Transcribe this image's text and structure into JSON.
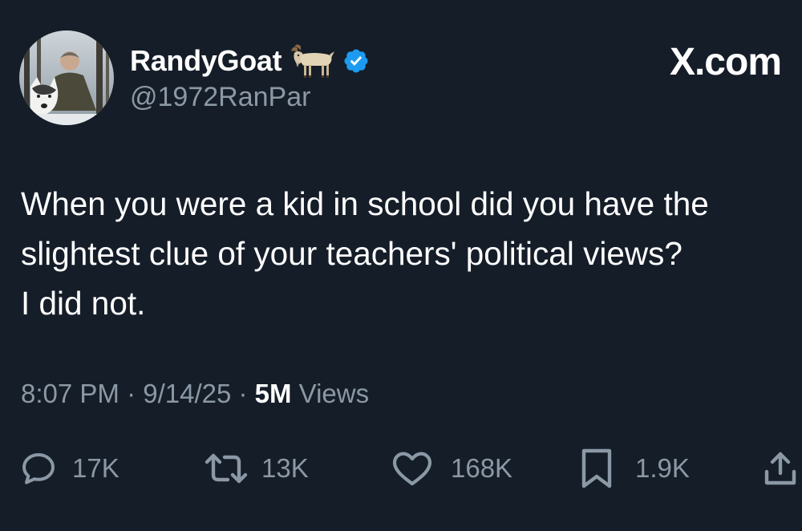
{
  "header": {
    "display_name": "RandyGoat",
    "handle": "@1972RanPar",
    "brand": "X.com",
    "icons": {
      "avatar": "profile-photo-man-with-husky",
      "badge_emoji": "goat-emoji",
      "verified": "verified-badge-icon"
    },
    "colors": {
      "background": "#151d28",
      "verified_blue": "#1d9bf0",
      "secondary_text": "#8b98a5"
    }
  },
  "tweet": {
    "text": "When you were a kid in school did you have the\nslightest clue of your teachers' political views?\nI did not."
  },
  "meta": {
    "time": "8:07 PM",
    "sep1": " · ",
    "date": "9/14/25",
    "sep2": " · ",
    "views_count": "5M",
    "views_label": " Views"
  },
  "actions": {
    "reply": {
      "icon": "reply-icon",
      "count": "17K"
    },
    "repost": {
      "icon": "repost-icon",
      "count": "13K"
    },
    "like": {
      "icon": "heart-icon",
      "count": "168K"
    },
    "bookmark": {
      "icon": "bookmark-icon",
      "count": "1.9K"
    },
    "share": {
      "icon": "share-icon"
    }
  }
}
